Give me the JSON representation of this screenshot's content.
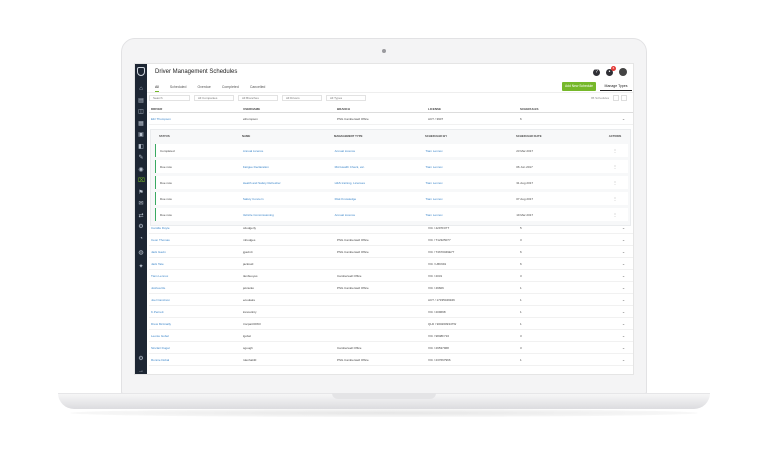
{
  "app": {
    "title": "Driver Management Schedules",
    "accent_color": "#76b82a",
    "sidebar_color": "#1d2633",
    "notification_count": "6"
  },
  "tabs": [
    {
      "label": "All",
      "active": true
    },
    {
      "label": "Scheduled",
      "active": false
    },
    {
      "label": "Overdue",
      "active": false
    },
    {
      "label": "Completed",
      "active": false
    },
    {
      "label": "Cancelled",
      "active": false
    }
  ],
  "actions": {
    "add_label": "Add New Schedule",
    "manage_label": "Manage Types"
  },
  "filters": [
    {
      "placeholder": "Search"
    },
    {
      "placeholder": "All Companies"
    },
    {
      "placeholder": "All Branches"
    },
    {
      "placeholder": "All Drivers"
    },
    {
      "placeholder": "All Types"
    }
  ],
  "result_count": "95 Schedules",
  "columns": [
    "DRIVER",
    "USERNAME",
    "BRANCH",
    "LICENSE",
    "SCHEDULES",
    ""
  ],
  "expanded_columns": [
    "STATUS",
    "NAME",
    "MANAGEMENT TYPE",
    "SCHEDULED BY",
    "SCHEDULED DATE",
    "ACTIONS"
  ],
  "top_row": {
    "driver": "Eliz Thompson",
    "username": "ethompson",
    "branch": "PSG Camberwell Office",
    "license": "ACT / 3907",
    "schedules": "6"
  },
  "expanded_rows": [
    {
      "status": "Completed",
      "name": "Annual Licence",
      "type": "Annual Licence",
      "by": "Tiam Lennox",
      "date": "23 Mar 2017"
    },
    {
      "status": "Due now",
      "name": "Fatigue Declaration",
      "type": "Mid Health Check, etc.",
      "by": "Tiam Lennox",
      "date": "06 Jun 2017"
    },
    {
      "status": "Due now",
      "name": "Health and Safety Refresher",
      "type": "H&S training, Licenses",
      "by": "Tiam Lennox",
      "date": "31 Aug 2017"
    },
    {
      "status": "Due now",
      "name": "Safety Concern",
      "type": "Risk Knowledge",
      "by": "Tiam Lennox",
      "date": "07 Aug 2017"
    },
    {
      "status": "Due now",
      "name": "Vehicle Commissioning",
      "type": "Annual Licence",
      "by": "Tiam Lennox",
      "date": "19 Mar 2017"
    }
  ],
  "rows": [
    {
      "driver": "Camille Doyle",
      "username": "cdodgerly",
      "branch": "",
      "license": "VIC / 4297F07T",
      "schedules": "5"
    },
    {
      "driver": "Ceon Thomas",
      "username": "mhodges",
      "branch": "PSG Camberwell Office",
      "license": "VIC / T12325077",
      "schedules": "3"
    },
    {
      "driver": "Jack Gavin",
      "username": "jgavin4",
      "branch": "PSG Camberwell Office",
      "license": "VIC / T4670049E77",
      "schedules": "6"
    },
    {
      "driver": "Jack Tate",
      "username": "jackreid",
      "branch": "",
      "license": "VIC / LBK991",
      "schedules": "6"
    },
    {
      "driver": "Tiam Lennox",
      "username": "tlenbuoyes",
      "branch": "Camberwell Office",
      "license": "VIC / 2031",
      "schedules": "3"
    },
    {
      "driver": "Joshua Re",
      "username": "jeknuiko",
      "branch": "PSG Camberwell Office",
      "license": "VIC / 49606",
      "schedules": "1"
    },
    {
      "driver": "Joel Cancinon",
      "username": "ecoulaire",
      "branch": "",
      "license": "ACT / 17335049946",
      "schedules": "1"
    },
    {
      "driver": "K.Pernett",
      "username": "ksnoutinty",
      "branch": "",
      "license": "VIC / 209698",
      "schedules": "1"
    },
    {
      "driver": "Drew McAnally",
      "username": "tmcpartIOW3",
      "branch": "",
      "license": "QLD / 9002609347W",
      "schedules": "1"
    },
    {
      "driver": "Leonie Gobel",
      "username": "lgobel",
      "branch": "",
      "license": "VIC / 9848F716",
      "schedules": "3"
    },
    {
      "driver": "Sinclair Dugal",
      "username": "sgough",
      "branch": "Camberwell Office",
      "license": "VIC / 29537968",
      "schedules": "3"
    },
    {
      "driver": "Ronnie Dobal",
      "username": "rdenhal40",
      "branch": "PSG Camberwell Office",
      "license": "VIC / 237667966",
      "schedules": "1"
    }
  ]
}
